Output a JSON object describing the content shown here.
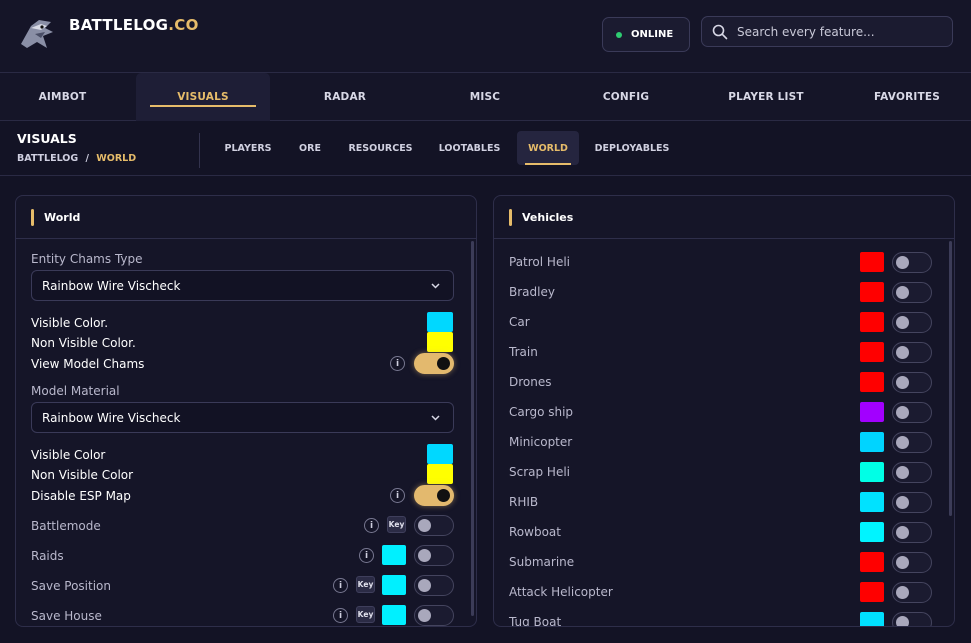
{
  "brand": {
    "name": "BATTLELOG",
    "suffix": ".CO"
  },
  "status": {
    "label": "ONLINE",
    "color": "#2ecc71"
  },
  "search": {
    "placeholder": "Search every feature..."
  },
  "nav": {
    "items": [
      "AIMBOT",
      "VISUALS",
      "RADAR",
      "MISC",
      "CONFIG",
      "PLAYER LIST",
      "FAVORITES"
    ],
    "active": "VISUALS"
  },
  "section": {
    "title": "VISUALS",
    "breadcrumb_root": "BATTLELOG",
    "breadcrumb_sep": "/",
    "breadcrumb_current": "WORLD"
  },
  "subtabs": {
    "items": [
      "PLAYERS",
      "ORE",
      "RESOURCES",
      "LOOTABLES",
      "WORLD",
      "DEPLOYABLES"
    ],
    "active": "WORLD"
  },
  "world": {
    "title": "World",
    "entity_chams_label": "Entity Chams Type",
    "entity_chams_value": "Rainbow Wire Vischeck",
    "visible_color_1": "Visible Color.",
    "non_visible_color_1": "Non Visible Color.",
    "view_model_chams": "View Model Chams",
    "model_material_label": "Model Material",
    "model_material_value": "Rainbow Wire Vischeck",
    "visible_color_2": "Visible Color",
    "non_visible_color_2": "Non Visible Color",
    "disable_esp_map": "Disable ESP Map",
    "battlemode": "Battlemode",
    "raids": "Raids",
    "save_position": "Save Position",
    "save_house": "Save House",
    "info_glyph": "i",
    "key_label": "Key",
    "colors": {
      "cyan": "#00d8ff",
      "yellow": "#ffff00",
      "teal": "#00f0ff"
    }
  },
  "vehicles": {
    "title": "Vehicles",
    "items": [
      {
        "name": "Patrol Heli",
        "color": "#ff0000"
      },
      {
        "name": "Bradley",
        "color": "#ff0000"
      },
      {
        "name": "Car",
        "color": "#ff0000"
      },
      {
        "name": "Train",
        "color": "#ff0000"
      },
      {
        "name": "Drones",
        "color": "#ff0000"
      },
      {
        "name": "Cargo ship",
        "color": "#a200ff"
      },
      {
        "name": "Minicopter",
        "color": "#00d4ff"
      },
      {
        "name": "Scrap Heli",
        "color": "#00ffe6"
      },
      {
        "name": "RHIB",
        "color": "#00e2ff"
      },
      {
        "name": "Rowboat",
        "color": "#00f4ff"
      },
      {
        "name": "Submarine",
        "color": "#ff0000"
      },
      {
        "name": "Attack Helicopter",
        "color": "#ff0000"
      },
      {
        "name": "Tug Boat",
        "color": "#00e0ff"
      }
    ]
  }
}
